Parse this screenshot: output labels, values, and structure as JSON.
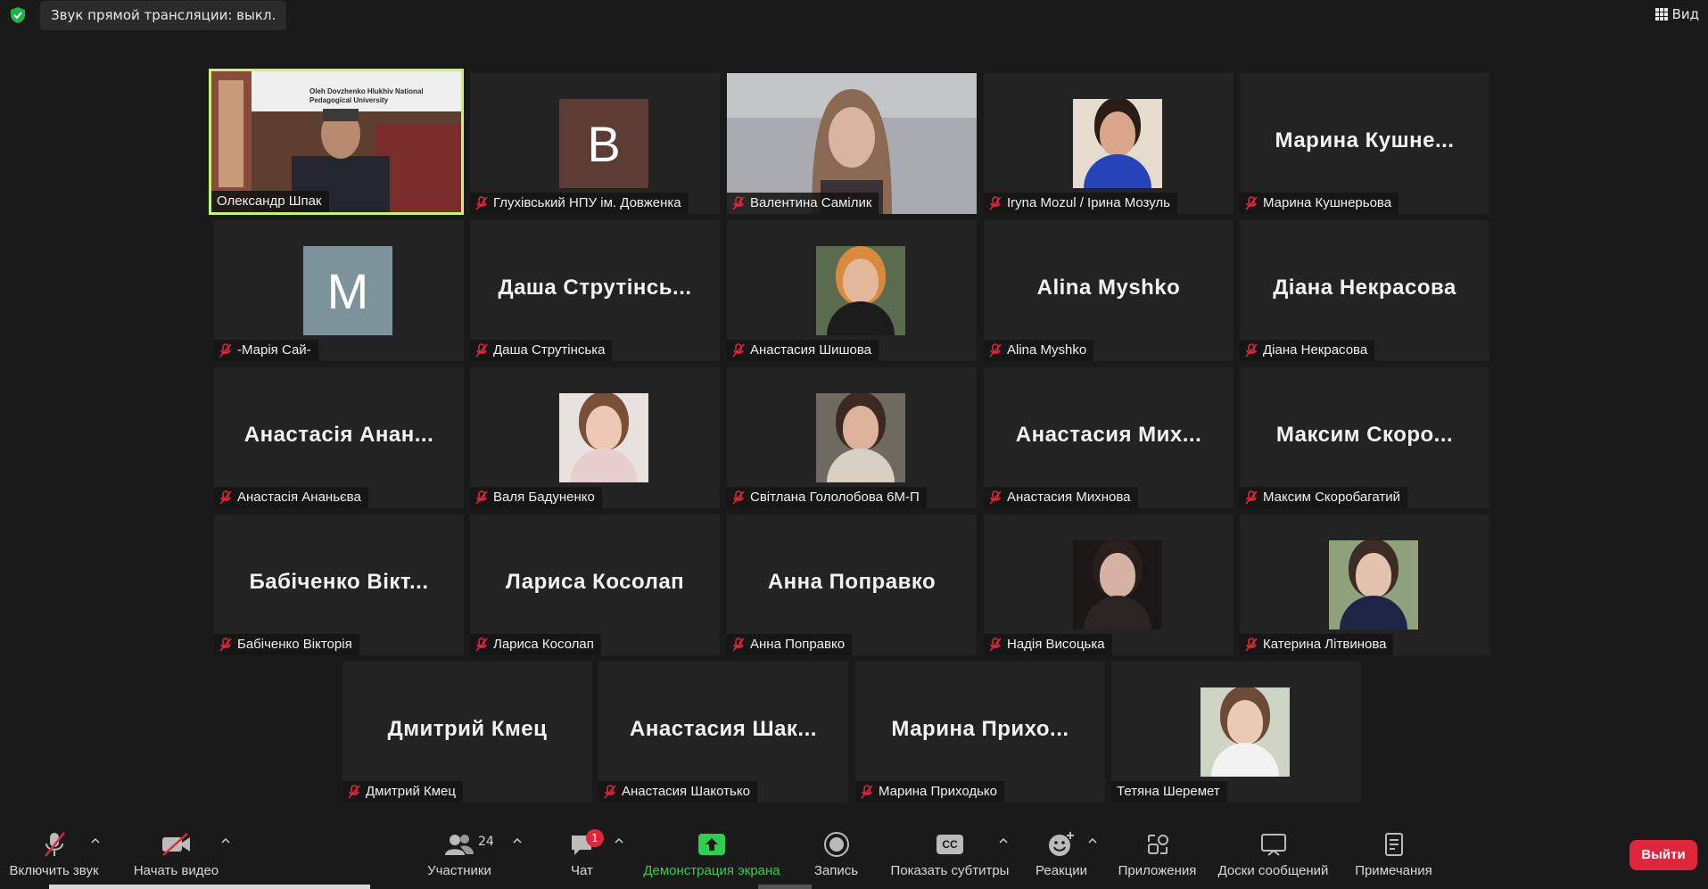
{
  "header": {
    "live_audio_status": "Звук прямой трансляции: выкл.",
    "view_label": "Вид"
  },
  "participants_grid": [
    {
      "display": "video",
      "name": "Олександр Шпак",
      "muted": false,
      "active_speaker": true,
      "banner_text": "Oleh Dovzhenko Hlukhiv National Pedagogical University"
    },
    {
      "display": "letter",
      "name": "Глухівський НПУ ім. Довженка",
      "letter": "В",
      "avatar_color": "#5c3c34",
      "muted": true
    },
    {
      "display": "video",
      "name": "Валентина Самілик",
      "muted": true
    },
    {
      "display": "photo",
      "name": "Iryna Mozul / Ірина Мозуль",
      "muted": true
    },
    {
      "display": "name",
      "name": "Марина Кушнерьова",
      "big_name": "Марина  Кушне...",
      "muted": true
    },
    {
      "display": "letter",
      "name": "-Марія Сай-",
      "letter": "M",
      "avatar_color": "#7d939c",
      "muted": true
    },
    {
      "display": "name",
      "name": "Даша Струтінська",
      "big_name": "Даша  Струтінсь...",
      "muted": true
    },
    {
      "display": "photo",
      "name": "Анастасия Шишова",
      "muted": true
    },
    {
      "display": "name",
      "name": "Alina Myshko",
      "big_name": "Alina Myshko",
      "muted": true
    },
    {
      "display": "name",
      "name": "Діана Некрасова",
      "big_name": "Діана Некрасова",
      "muted": true
    },
    {
      "display": "name",
      "name": "Анастасія Ананьєва",
      "big_name": "Анастасія  Анан...",
      "muted": true
    },
    {
      "display": "photo",
      "name": "Валя Бадуненко",
      "muted": true
    },
    {
      "display": "photo",
      "name": "Світлана Гололобова 6М-П",
      "muted": true
    },
    {
      "display": "name",
      "name": "Анастасия Михнова",
      "big_name": "Анастасия  Мих...",
      "muted": true
    },
    {
      "display": "name",
      "name": "Максим Скоробагатий",
      "big_name": "Максим  Скоро...",
      "muted": true
    },
    {
      "display": "name",
      "name": "Бабіченко Вікторія",
      "big_name": "Бабіченко  Вікт...",
      "muted": true
    },
    {
      "display": "name",
      "name": "Лариса Косолап",
      "big_name": "Лариса Косолап",
      "muted": true
    },
    {
      "display": "name",
      "name": "Анна Поправко",
      "big_name": "Анна Поправко",
      "muted": true
    },
    {
      "display": "photo",
      "name": "Надія Висоцька",
      "muted": true
    },
    {
      "display": "photo",
      "name": "Катерина Літвинова",
      "muted": true
    },
    {
      "display": "name",
      "name": "Дмитрий Кмец",
      "big_name": "Дмитрий Кмец",
      "muted": true
    },
    {
      "display": "name",
      "name": "Анастасия Шакотько",
      "big_name": "Анастасия  Шак...",
      "muted": true
    },
    {
      "display": "name",
      "name": "Марина Приходько",
      "big_name": "Марина  Прихо...",
      "muted": true
    },
    {
      "display": "photo",
      "name": "Тетяна Шеремет",
      "muted": false
    }
  ],
  "toolbar": {
    "unmute_label": "Включить звук",
    "start_video_label": "Начать видео",
    "participants_label": "Участники",
    "participants_count": "24",
    "chat_label": "Чат",
    "chat_unread": "1",
    "share_screen_label": "Демонстрация экрана",
    "record_label": "Запись",
    "captions_label": "Показать субтитры",
    "captions_icon_text": "CC",
    "reactions_label": "Реакции",
    "apps_label": "Приложения",
    "whiteboards_label": "Доски сообщений",
    "notes_label": "Примечания",
    "leave_label": "Выйти"
  },
  "colors": {
    "active_speaker_border": "#c8f46b",
    "share_screen_green": "#2ecf4f",
    "leave_red": "#e0263a",
    "muted_mic_red": "#e0263a"
  }
}
